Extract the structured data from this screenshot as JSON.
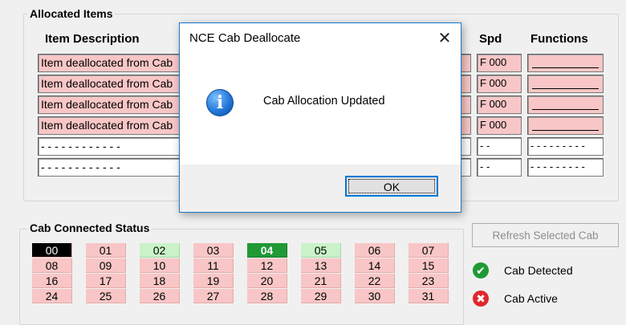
{
  "allocated": {
    "group_title": "Allocated Items",
    "headers": {
      "item_description": "Item Description",
      "spd": "Spd",
      "functions": "Functions"
    },
    "rows": [
      {
        "description": "Item deallocated from Cab",
        "spd": "F 000",
        "functions": "",
        "filled": true
      },
      {
        "description": "Item deallocated from Cab",
        "spd": "F 000",
        "functions": "",
        "filled": true
      },
      {
        "description": "Item deallocated from Cab",
        "spd": "F 000",
        "functions": "",
        "filled": true
      },
      {
        "description": "Item deallocated from Cab",
        "spd": "F 000",
        "functions": "",
        "filled": true
      },
      {
        "description": "- - - - - - - - - - - -",
        "spd": "- -",
        "functions": "- - - - - - - - -",
        "filled": false
      },
      {
        "description": "- - - - - - - - - - - -",
        "spd": "- -",
        "functions": "- - - - - - - - -",
        "filled": false
      }
    ]
  },
  "cab_status": {
    "group_title": "Cab Connected Status",
    "cabs": [
      {
        "label": "00",
        "state": "black"
      },
      {
        "label": "01",
        "state": "pink"
      },
      {
        "label": "02",
        "state": "lightgreen"
      },
      {
        "label": "03",
        "state": "pink"
      },
      {
        "label": "04",
        "state": "green"
      },
      {
        "label": "05",
        "state": "lightgreen"
      },
      {
        "label": "06",
        "state": "pink"
      },
      {
        "label": "07",
        "state": "pink"
      },
      {
        "label": "08",
        "state": "pink"
      },
      {
        "label": "09",
        "state": "pink"
      },
      {
        "label": "10",
        "state": "pink"
      },
      {
        "label": "11",
        "state": "pink"
      },
      {
        "label": "12",
        "state": "pink"
      },
      {
        "label": "13",
        "state": "pink"
      },
      {
        "label": "14",
        "state": "pink"
      },
      {
        "label": "15",
        "state": "pink"
      },
      {
        "label": "16",
        "state": "pink"
      },
      {
        "label": "17",
        "state": "pink"
      },
      {
        "label": "18",
        "state": "pink"
      },
      {
        "label": "19",
        "state": "pink"
      },
      {
        "label": "20",
        "state": "pink"
      },
      {
        "label": "21",
        "state": "pink"
      },
      {
        "label": "22",
        "state": "pink"
      },
      {
        "label": "23",
        "state": "pink"
      },
      {
        "label": "24",
        "state": "pink"
      },
      {
        "label": "25",
        "state": "pink"
      },
      {
        "label": "26",
        "state": "pink"
      },
      {
        "label": "27",
        "state": "pink"
      },
      {
        "label": "28",
        "state": "pink"
      },
      {
        "label": "29",
        "state": "pink"
      },
      {
        "label": "30",
        "state": "pink"
      },
      {
        "label": "31",
        "state": "pink"
      }
    ]
  },
  "refresh_button": {
    "label": "Refresh Selected Cab"
  },
  "legend": {
    "detected": {
      "label": "Cab Detected",
      "icon": "check-circle-icon",
      "color": "#1f9a35"
    },
    "active": {
      "label": "Cab Active",
      "icon": "x-circle-icon",
      "color": "#e0282c"
    }
  },
  "dialog": {
    "title": "NCE Cab Deallocate",
    "message": "Cab Allocation Updated",
    "ok_label": "OK",
    "close_glyph": "✕",
    "icon": "info-icon",
    "icon_glyph": "i"
  }
}
